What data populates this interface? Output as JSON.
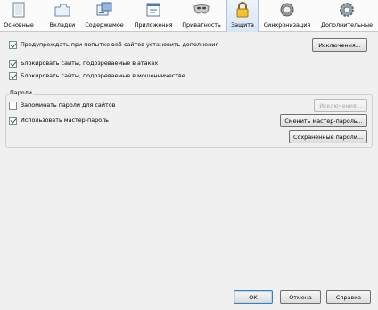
{
  "toolbar": {
    "tabs": [
      {
        "label": "Основные",
        "icon": "general-icon"
      },
      {
        "label": "Вкладки",
        "icon": "tabs-icon"
      },
      {
        "label": "Содержимое",
        "icon": "content-icon"
      },
      {
        "label": "Приложения",
        "icon": "applications-icon"
      },
      {
        "label": "Приватность",
        "icon": "privacy-mask-icon"
      },
      {
        "label": "Защита",
        "icon": "lock-icon"
      },
      {
        "label": "Синхронизация",
        "icon": "sync-icon"
      },
      {
        "label": "Дополнительные",
        "icon": "gear-icon"
      }
    ],
    "selected": "Защита"
  },
  "security": {
    "warn_addons": {
      "label": "Предупреждать при попытке веб-сайтов установить дополнения",
      "checked": true
    },
    "exceptions_button": "Исключения...",
    "block_attack": {
      "label": "Блокировать сайты, подозреваемые в атаках",
      "checked": true
    },
    "block_forgery": {
      "label": "Блокировать сайты, подозреваемые в мошенничестве",
      "checked": true
    }
  },
  "passwords": {
    "title": "Пароли",
    "remember": {
      "label": "Запоминать пароли для сайтов",
      "checked": false
    },
    "exceptions_button": "Исключения...",
    "master": {
      "label": "Использовать мастер-пароль",
      "checked": true
    },
    "change_master_button": "Сменить мастер-пароль...",
    "saved_passwords_button": "Сохранённые пароли..."
  },
  "footer": {
    "ok": "ОК",
    "cancel": "Отмена",
    "help": "Справка"
  },
  "colors": {
    "selected_tab": "#d6e5f6",
    "background": "#f0f0f0",
    "toolbar": "#fbfbfb"
  }
}
